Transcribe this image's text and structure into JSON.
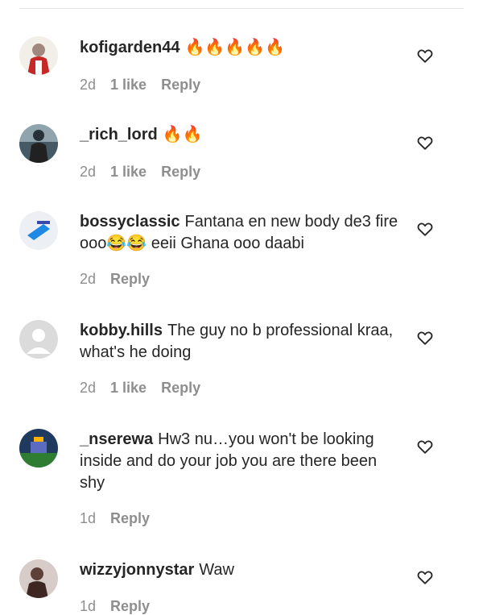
{
  "comments": [
    {
      "username": "kofigarden44",
      "text": "🔥🔥🔥🔥🔥",
      "time": "2d",
      "likes": "1 like",
      "reply": "Reply",
      "avatar_color": "#b71c1c"
    },
    {
      "username": "_rich_lord",
      "text": "🔥🔥",
      "time": "2d",
      "likes": "1 like",
      "reply": "Reply",
      "avatar_color": "#37474f"
    },
    {
      "username": "bossyclassic",
      "text": "Fantana en new body de3 fire ooo😂😂 eeii Ghana ooo daabi",
      "time": "2d",
      "likes": "",
      "reply": "Reply",
      "avatar_color": "#e8eaf0"
    },
    {
      "username": "kobby.hills",
      "text": "The guy no b professional kraa, what's he doing",
      "time": "2d",
      "likes": "1 like",
      "reply": "Reply",
      "avatar_color": "#dbdbdb"
    },
    {
      "username": "_nserewa",
      "text": "Hw3 nu…you won't be looking inside and do your job you are there been shy",
      "time": "1d",
      "likes": "",
      "reply": "Reply",
      "avatar_color": "#1e3a5f"
    },
    {
      "username": "wizzyjonnystar",
      "text": "Waw",
      "time": "1d",
      "likes": "",
      "reply": "Reply",
      "avatar_color": "#8d6e63"
    }
  ]
}
